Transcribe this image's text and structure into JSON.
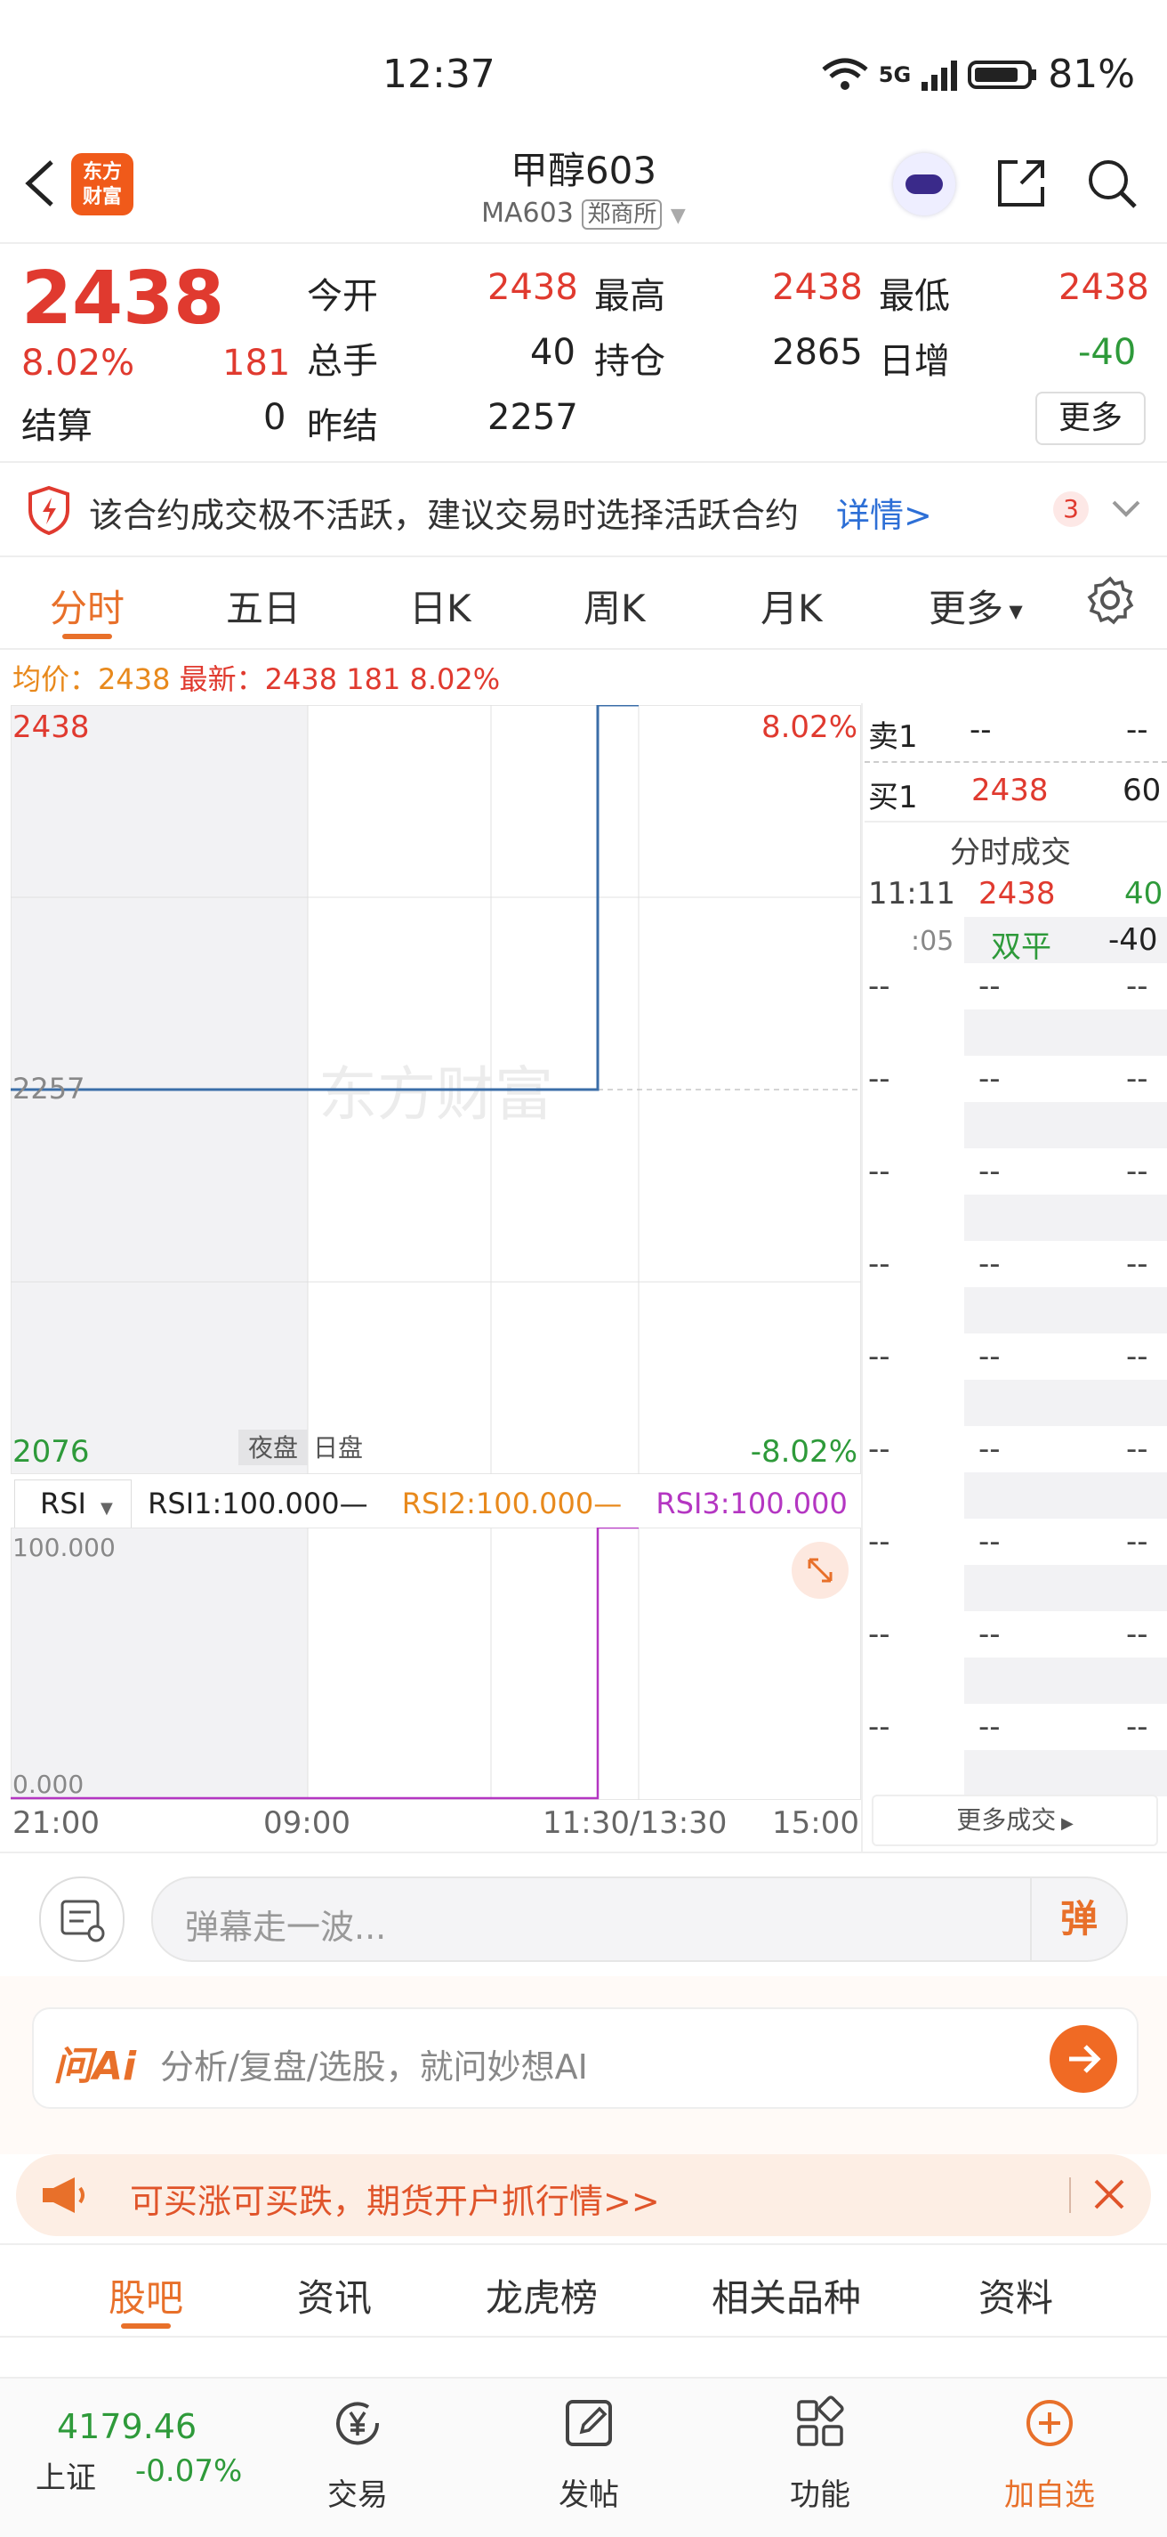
{
  "status_bar": {
    "time": "12:37",
    "network": "5G",
    "battery": "81%"
  },
  "header": {
    "logo_text": "东方财富",
    "title": "甲醇603",
    "code": "MA603",
    "exchange": "郑商所"
  },
  "quote": {
    "price": "2438",
    "change_pct": "8.02%",
    "change": "181",
    "open_label": "今开",
    "open": "2438",
    "high_label": "最高",
    "high": "2438",
    "low_label": "最低",
    "low": "2438",
    "volume_label": "总手",
    "volume": "40",
    "oi_label": "持仓",
    "oi": "2865",
    "oi_change_label": "日增",
    "oi_change": "-40",
    "settle_label": "结算",
    "settle": "0",
    "prev_settle_label": "昨结",
    "prev_settle": "2257",
    "more_button": "更多"
  },
  "alert": {
    "text": "该合约成交极不活跃，建议交易时选择活跃合约",
    "link": "详情>",
    "count": "3"
  },
  "tabs": [
    "分时",
    "五日",
    "日K",
    "周K",
    "月K",
    "更多"
  ],
  "chart_info": {
    "avg_label": "均价：",
    "avg": "2438",
    "latest_label": "最新：",
    "latest": "2438",
    "change": "181",
    "pct": "8.02%"
  },
  "chart_data": {
    "type": "line",
    "x_ticks": [
      "21:00",
      "09:00",
      "11:30/13:30",
      "15:00"
    ],
    "y_max": "2438",
    "y_ref": "2257",
    "y_min": "2076",
    "pct_max": "8.02%",
    "pct_min": "-8.02%",
    "session_labels": [
      "夜盘",
      "日盘"
    ],
    "watermark": "东方财富",
    "series": [
      {
        "values": [
          2257,
          2257,
          2257,
          2438,
          2438
        ]
      }
    ],
    "ylim": [
      2076,
      2438
    ]
  },
  "rsi": {
    "label": "RSI",
    "rsi1": "RSI1:100.000—",
    "rsi2": "RSI2:100.000—",
    "rsi3": "RSI3:100.000—",
    "max": "100.000",
    "min": "0.000"
  },
  "order_book": {
    "sell1_label": "卖1",
    "sell1_price": "--",
    "sell1_vol": "--",
    "buy1_label": "买1",
    "buy1_price": "2438",
    "buy1_vol": "60",
    "trades_title": "分时成交",
    "trade1_time": "11:11",
    "trade1_price": "2438",
    "trade1_vol": "40",
    "trade2_time": ":05",
    "trade2_type": "双平",
    "trade2_vol": "-40",
    "placeholder": "--",
    "more_trades": "更多成交"
  },
  "barrage": {
    "placeholder": "弹幕走一波...",
    "button": "弹"
  },
  "ai": {
    "brand": "问Ai",
    "placeholder": "分析/复盘/选股，就问妙想AI"
  },
  "promo": {
    "text": "可买涨可买跌，期货开户抓行情>>"
  },
  "bottom_tabs": [
    "股吧",
    "资讯",
    "龙虎榜",
    "相关品种",
    "资料"
  ],
  "nav": {
    "index_value": "4179.46",
    "index_name": "上证",
    "index_pct": "-0.07%",
    "trade": "交易",
    "post": "发帖",
    "features": "功能",
    "add_watch": "加自选"
  }
}
